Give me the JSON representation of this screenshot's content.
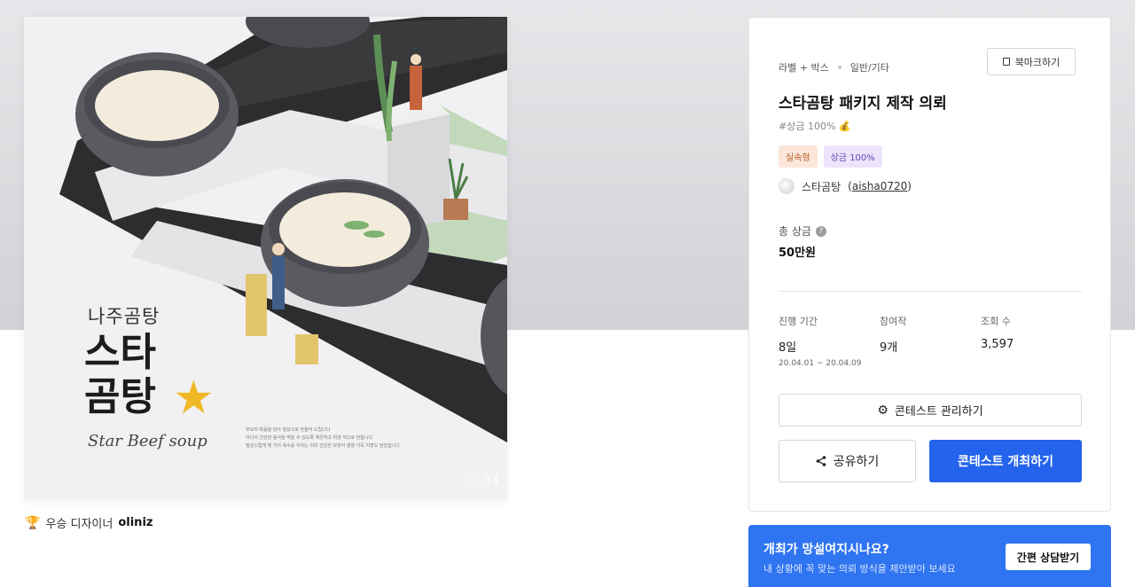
{
  "artwork": {
    "title_small": "나주곰탕",
    "title_big": "스타\n곰탕",
    "star_icon": "star-icon",
    "script_text": "Star Beef soup",
    "fine_print": [
      "부모의 마음을 담아 정성으로 만들어 드립니다",
      "어디서 건강한 음식을 먹을 수 있도록 깨끗하고 위생 적으로 만듭니다",
      "정성스럽게 몇 가지 육수를 우리는 이미 건강한 보양식 영양 가득 지방도 담았습니다"
    ],
    "like_count": "33",
    "like_icon": "heart-icon"
  },
  "designer": {
    "prefix": "우승 디자이너",
    "name": "oliniz",
    "icon": "trophy-icon"
  },
  "contest": {
    "category": "라벨 + 박스",
    "subcategory": "일반/기타",
    "bookmark_label": "북마크하기",
    "title": "스타곰탕 패키지 제작 의뢰",
    "hashtag": "#상금 100% 💰",
    "badges": [
      "실속형",
      "상금 100%"
    ],
    "owner_name": "스타곰탕",
    "owner_id": "aisha0720",
    "prize_label": "총 상금",
    "prize_help": "?",
    "prize_value": "50만원",
    "stats": {
      "period_label": "진행 기간",
      "period_value": "8일",
      "period_range": "20.04.01 ~ 20.04.09",
      "participants_label": "참여작",
      "participants_value": "9개",
      "views_label": "조회 수",
      "views_value": "3,597"
    },
    "manage_button": "콘테스트 관리하기",
    "share_button": "공유하기",
    "open_button": "콘테스트 개최하기"
  },
  "consult": {
    "headline": "개최가 망설여지시나요?",
    "sub": "내 상황에 꼭 맞는 의뢰 방식을 제안받아 보세요",
    "button": "간편 상담받기"
  },
  "colors": {
    "primary": "#2463eb",
    "banner": "#2f74f0",
    "star": "#f0b825"
  }
}
